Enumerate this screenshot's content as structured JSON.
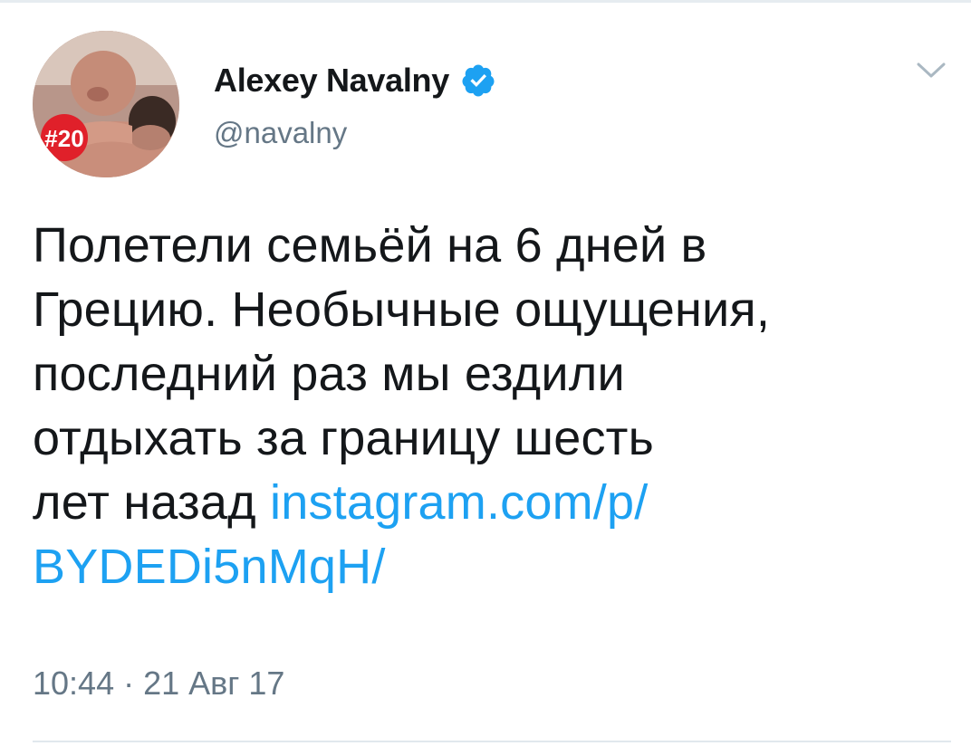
{
  "author": {
    "display_name": "Alexey Navalny",
    "handle": "@navalny",
    "avatar_badge": "#20",
    "verified": true
  },
  "tweet": {
    "text_lines": [
      "Полетели семьёй на 6 дней в",
      "Грецию. Необычные ощущения,",
      "последний раз мы ездили",
      "отдыхать за границу шесть",
      "лет назад "
    ],
    "link_line1": "instagram.com/p/",
    "link_line2": "BYDEDi5nMqH/",
    "timestamp": "10:44 · 21 Авг 17"
  },
  "icons": {
    "verified": "verified-badge-icon",
    "menu": "chevron-down-icon"
  },
  "colors": {
    "link": "#1da1f2",
    "secondary_text": "#657786",
    "primary_text": "#14171a",
    "verified_badge": "#1da1f2",
    "avatar_badge": "#e0202a"
  }
}
